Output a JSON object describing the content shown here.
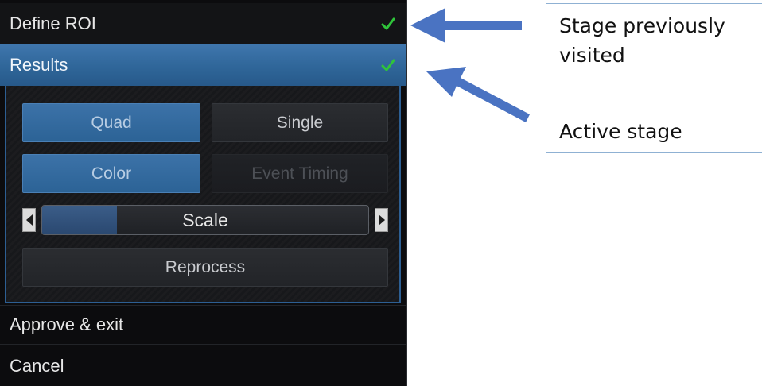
{
  "panel": {
    "stages": {
      "define_roi": {
        "label": "Define ROI",
        "visited": true
      },
      "results": {
        "label": "Results",
        "visited": true,
        "active": true
      },
      "approve": {
        "label": "Approve & exit"
      },
      "cancel": {
        "label": "Cancel"
      }
    },
    "results": {
      "quad_label": "Quad",
      "single_label": "Single",
      "color_label": "Color",
      "event_timing_label": "Event Timing",
      "scale": {
        "label": "Scale",
        "fraction": 0.23
      },
      "reprocess_label": "Reprocess"
    }
  },
  "callouts": {
    "visited": "Stage previously visited",
    "active": "Active stage"
  },
  "colors": {
    "accent_blue": "#3f76ad",
    "check_green": "#2fc43a",
    "arrow_blue": "#4a73c2"
  },
  "icons": [
    "check-icon",
    "arrow-left-icon",
    "arrow-right-icon"
  ]
}
